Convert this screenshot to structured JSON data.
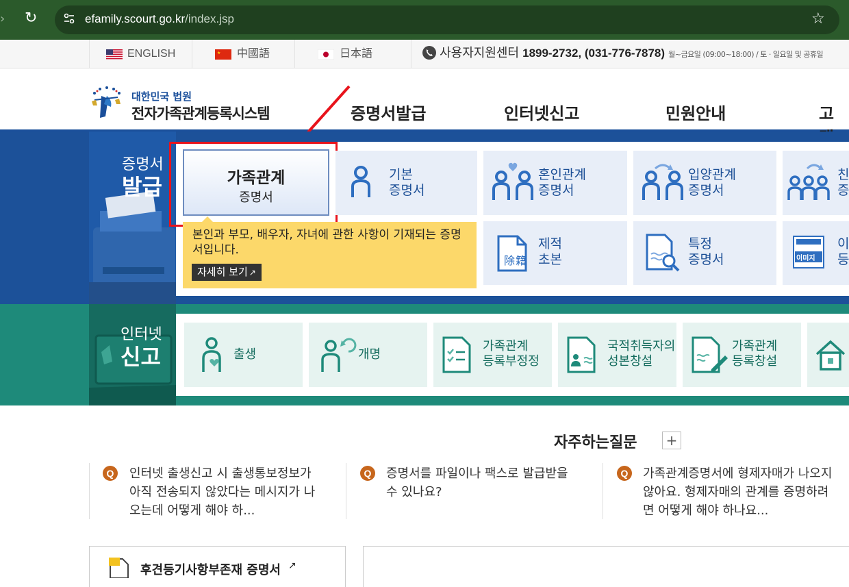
{
  "browser": {
    "url_host": "efamily.scourt.go.kr",
    "url_path": "/index.jsp"
  },
  "topbar": {
    "languages": [
      "ENGLISH",
      "中國語",
      "日本語"
    ],
    "support_label": "사용자지원센터",
    "support_phone": "1899-2732, (031-776-7878)",
    "support_hours": "월~금요일 (09:00~18:00) / 토 · 일요일 및 공휴일"
  },
  "header": {
    "logo_top": "대한민국 법원",
    "logo_main": "전자가족관계등록시스템",
    "nav": [
      "증명서발급",
      "인터넷신고",
      "민원안내",
      "고객"
    ]
  },
  "cert": {
    "side_line1": "증명서",
    "side_line2": "발급",
    "active_title": "가족관계",
    "active_sub": "증명서",
    "desc": "본인과 부모, 배우자, 자녀에 관한 사항이 기재되는 증명서입니다.",
    "detail_button": "자세히 보기",
    "tiles": [
      {
        "line1": "기본",
        "line2": "증명서"
      },
      {
        "line1": "혼인관계",
        "line2": "증명서"
      },
      {
        "line1": "입양관계",
        "line2": "증명서"
      },
      {
        "line1": "친",
        "line2": "증"
      },
      {
        "line1": "제적",
        "line2": "초본"
      },
      {
        "line1": "특정",
        "line2": "증명서"
      },
      {
        "line1": "이",
        "line2": "등"
      }
    ],
    "jejeok_icon_text": "除籍",
    "image_icon_text": "이미지"
  },
  "net": {
    "side_line1": "인터넷",
    "side_line2": "신고",
    "tiles": [
      {
        "line1": "출생",
        "line2": ""
      },
      {
        "line1": "개명",
        "line2": ""
      },
      {
        "line1": "가족관계",
        "line2": "등록부정정"
      },
      {
        "line1": "국적취득자의",
        "line2": "성본창설"
      },
      {
        "line1": "가족관계",
        "line2": "등록창설"
      }
    ]
  },
  "faq": {
    "title": "자주하는질문",
    "more": "+",
    "items": [
      {
        "lines": [
          "인터넷 출생신고 시 출생통보정보가",
          "아직 전송되지 않았다는 메시지가 나",
          "오는데 어떻게 해야 하..."
        ]
      },
      {
        "lines": [
          "증명서를 파일이나 팩스로 발급받을",
          "수 있나요?",
          ""
        ]
      },
      {
        "lines": [
          "가족관계증명서에 형제자매가 나오지",
          "않아요. 형제자매의 관계를 증명하려",
          "면 어떻게 해야 하나요..."
        ]
      }
    ]
  },
  "bottom": {
    "guardian_link": "후견등기사항부존재 증명서"
  },
  "colors": {
    "cert_blue": "#1c5199",
    "net_green": "#1e8a7a",
    "highlight_red": "#e8131b",
    "desc_yellow": "#fcd86a"
  }
}
